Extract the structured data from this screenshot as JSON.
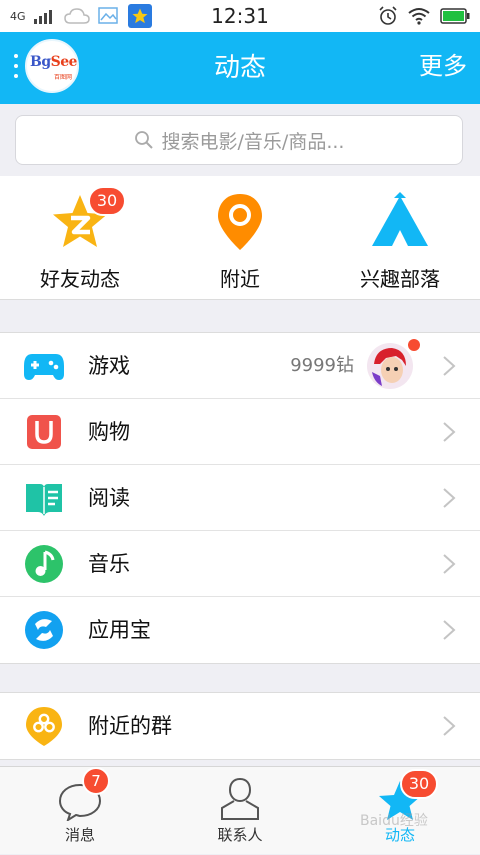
{
  "status_bar": {
    "network": "4G",
    "time": "12:31"
  },
  "header": {
    "title": "动态",
    "more": "更多",
    "avatar_logo_main": "Bg",
    "avatar_logo_accent": "See",
    "avatar_logo_sub": "百图网"
  },
  "search": {
    "placeholder": "搜索电影/音乐/商品..."
  },
  "quick": [
    {
      "label": "好友动态",
      "badge": "30",
      "icon": "qzone-star-icon",
      "color": "#f9b413"
    },
    {
      "label": "附近",
      "icon": "location-pin-icon",
      "color": "#ff8c00"
    },
    {
      "label": "兴趣部落",
      "icon": "tribe-tent-icon",
      "color": "#12b7f5"
    }
  ],
  "list1": [
    {
      "label": "游戏",
      "extra": "9999钻",
      "icon": "gamepad-icon",
      "color": "#12b7f5"
    },
    {
      "label": "购物",
      "icon": "shopping-bag-icon",
      "color": "#f0534b"
    },
    {
      "label": "阅读",
      "icon": "book-icon",
      "color": "#1fc3a6"
    },
    {
      "label": "音乐",
      "icon": "music-note-icon",
      "color": "#2dc36a"
    },
    {
      "label": "应用宝",
      "icon": "app-store-icon",
      "color": "#12a1f0"
    }
  ],
  "list2": [
    {
      "label": "附近的群",
      "icon": "nearby-group-icon",
      "color": "#f9b413"
    }
  ],
  "tabs": [
    {
      "label": "消息",
      "badge": "7",
      "icon": "message-bubble-icon"
    },
    {
      "label": "联系人",
      "icon": "contacts-icon"
    },
    {
      "label": "动态",
      "badge": "30",
      "icon": "activity-star-icon",
      "active": true
    }
  ],
  "watermark": "Baidu经验"
}
